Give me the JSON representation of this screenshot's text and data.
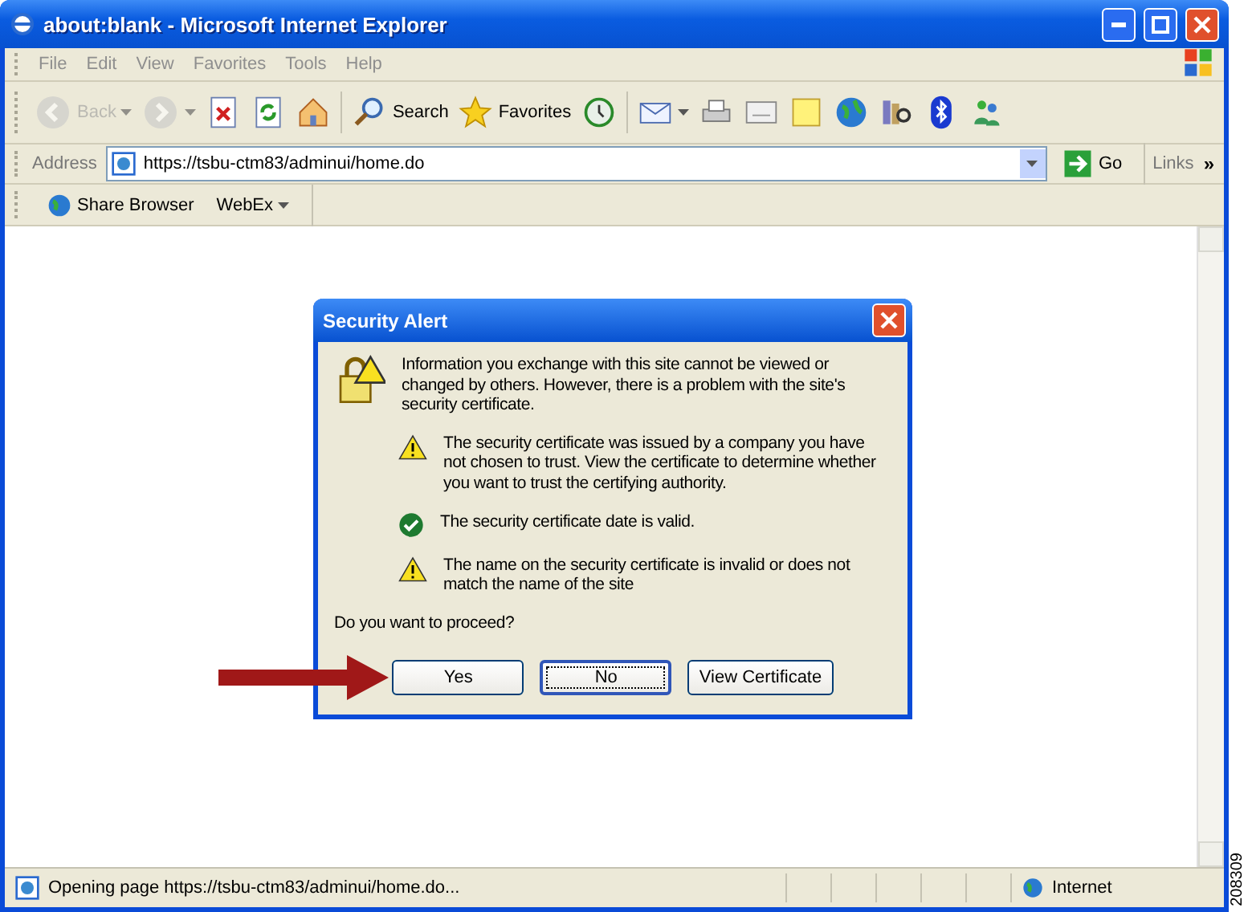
{
  "window": {
    "title": "about:blank - Microsoft Internet Explorer"
  },
  "menu": [
    "File",
    "Edit",
    "View",
    "Favorites",
    "Tools",
    "Help"
  ],
  "toolbar": [
    {
      "kind": "back",
      "label": "Back",
      "disabled": true
    },
    {
      "kind": "forward",
      "disabled": true
    },
    {
      "kind": "stop",
      "disabled": false
    },
    {
      "kind": "refresh",
      "disabled": false
    },
    {
      "kind": "home",
      "disabled": false
    },
    {
      "kind": "search",
      "label": "Search",
      "disabled": false
    },
    {
      "kind": "favorites",
      "label": "Favorites",
      "disabled": false
    },
    {
      "kind": "history",
      "disabled": false
    },
    {
      "kind": "mail",
      "disabled": false
    },
    {
      "kind": "print",
      "disabled": false
    },
    {
      "kind": "edit",
      "disabled": false
    },
    {
      "kind": "notes",
      "disabled": false
    },
    {
      "kind": "globe",
      "disabled": false
    },
    {
      "kind": "research",
      "disabled": false
    },
    {
      "kind": "bluetooth",
      "disabled": false
    },
    {
      "kind": "messenger",
      "disabled": false
    }
  ],
  "address_bar": {
    "label": "Address",
    "value": "https://tsbu-ctm83/adminui/home.do",
    "go": "Go",
    "links": "Links",
    "more": "»"
  },
  "links_bar": [
    {
      "kind": "share",
      "label": "Share Browser"
    },
    {
      "kind": "webex",
      "label": "WebEx"
    }
  ],
  "dialog": {
    "title": "Security Alert",
    "intro": "Information you exchange with this site cannot be viewed or changed by others. However, there is a problem with the site's security certificate.",
    "messages": [
      {
        "kind": "warning",
        "text": "The security certificate was issued by a company you have not chosen to trust. View the certificate to determine whether you want to trust the certifying authority."
      },
      {
        "kind": "ok",
        "text": "The security certificate date is valid."
      },
      {
        "kind": "warning",
        "text": "The name on the security certificate is invalid or does not match the name of the site"
      }
    ],
    "question": "Do you want to proceed?",
    "buttons": [
      {
        "label": "Yes",
        "focused": false,
        "pointed": true
      },
      {
        "label": "No",
        "focused": true,
        "pointed": false
      },
      {
        "label": "View Certificate",
        "focused": false,
        "pointed": false
      }
    ]
  },
  "status_bar": {
    "text": "Opening page https://tsbu-ctm83/adminui/home.do...",
    "zone": "Internet"
  },
  "figure_id": "208309"
}
